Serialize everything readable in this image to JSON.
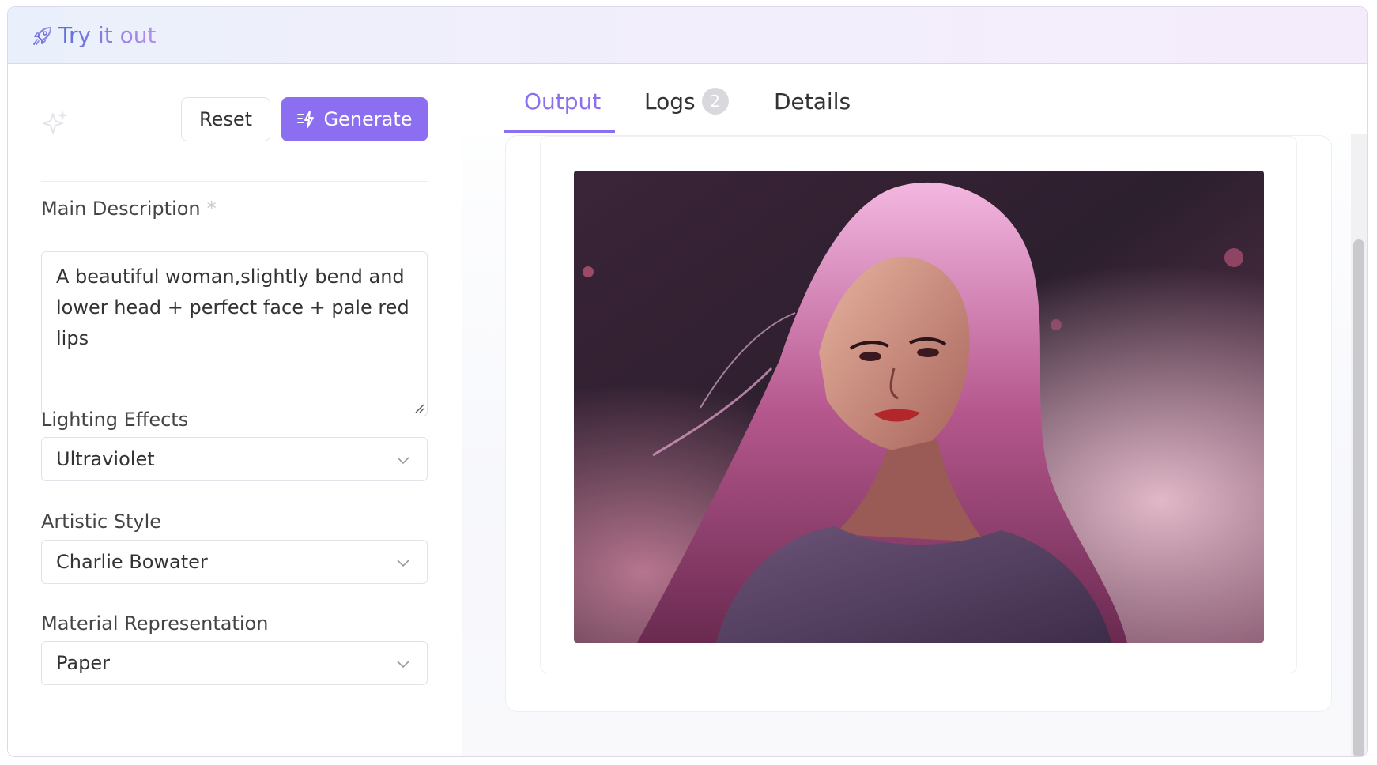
{
  "header": {
    "title": "Try it out",
    "icon": "rocket-icon"
  },
  "form": {
    "reset_label": "Reset",
    "generate_label": "Generate",
    "main_description": {
      "label": "Main Description",
      "required_mark": "*",
      "value": "A beautiful woman,slightly bend and lower head + perfect face + pale red lips"
    },
    "lighting_effects": {
      "label": "Lighting Effects",
      "value": "Ultraviolet"
    },
    "artistic_style": {
      "label": "Artistic Style",
      "value": "Charlie Bowater"
    },
    "material_representation": {
      "label": "Material Representation",
      "value": "Paper"
    }
  },
  "tabs": [
    {
      "label": "Output",
      "active": true
    },
    {
      "label": "Logs",
      "badge": "2",
      "active": false
    },
    {
      "label": "Details",
      "active": false
    }
  ],
  "colors": {
    "accent": "#8b6ff0",
    "title_gradient_start": "#5b6fd8",
    "title_gradient_end": "#b58df0",
    "badge_bg": "#d9d9dd"
  }
}
